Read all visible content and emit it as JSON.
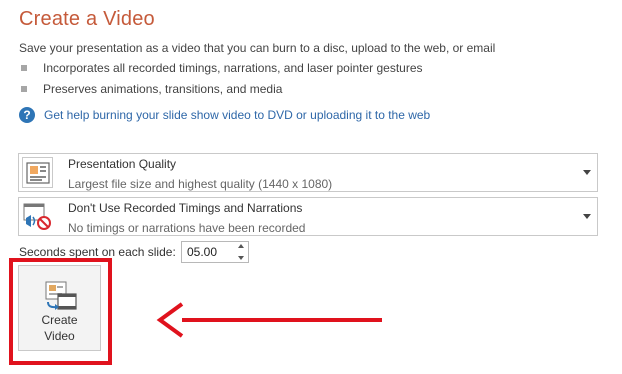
{
  "header": {
    "title": "Create a Video",
    "description": "Save your presentation as a video that you can burn to a disc, upload to the web, or email"
  },
  "features": [
    "Incorporates all recorded timings, narrations, and laser pointer gestures",
    "Preserves animations, transitions, and media"
  ],
  "help": {
    "icon": "help-icon",
    "glyph": "?",
    "link_text": "Get help burning your slide show video to DVD or uploading it to the web"
  },
  "quality_dropdown": {
    "icon": "presentation-quality-icon",
    "selected": "Presentation Quality",
    "description": "Largest file size and highest quality (1440 x 1080)"
  },
  "timings_dropdown": {
    "icon": "no-timings-narrations-icon",
    "selected": "Don't Use Recorded Timings and Narrations",
    "description": "No timings or narrations have been recorded"
  },
  "seconds": {
    "label": "Seconds spent on each slide:",
    "value": "05.00"
  },
  "create_button": {
    "icon": "create-video-icon",
    "line1": "Create",
    "line2": "Video"
  },
  "annotation": {
    "highlight_color": "#e0121d",
    "arrow_color": "#e0121d"
  },
  "colors": {
    "title": "#c55a3a",
    "link": "#2e67a8",
    "help_icon": "#2e75b6"
  }
}
